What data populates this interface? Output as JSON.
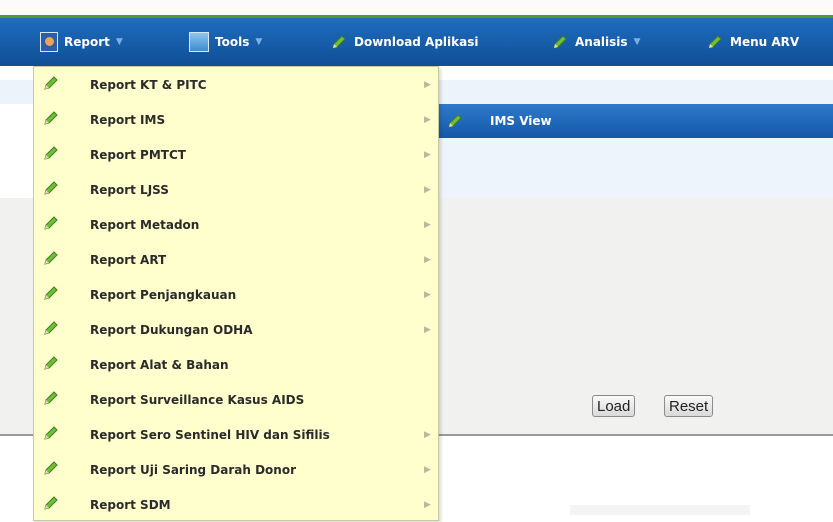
{
  "nav": {
    "report": "Report",
    "tools": "Tools",
    "download": "Download Aplikasi",
    "analisis": "Analisis",
    "menu_arv": "Menu ARV"
  },
  "submenu": {
    "ims_view": "IMS View"
  },
  "buttons": {
    "load": "Load",
    "reset": "Reset"
  },
  "menu_items": [
    {
      "label": "Report KT & PITC",
      "has_submenu": true
    },
    {
      "label": "Report IMS",
      "has_submenu": true
    },
    {
      "label": "Report PMTCT",
      "has_submenu": true
    },
    {
      "label": "Report LJSS",
      "has_submenu": true
    },
    {
      "label": "Report Metadon",
      "has_submenu": true
    },
    {
      "label": "Report ART",
      "has_submenu": true
    },
    {
      "label": "Report Penjangkauan",
      "has_submenu": true
    },
    {
      "label": "Report Dukungan ODHA",
      "has_submenu": true
    },
    {
      "label": "Report Alat & Bahan",
      "has_submenu": false
    },
    {
      "label": "Report Surveillance Kasus AIDS",
      "has_submenu": false
    },
    {
      "label": "Report Sero Sentinel HIV dan Sifilis",
      "has_submenu": true
    },
    {
      "label": "Report Uji Saring Darah Donor",
      "has_submenu": true
    },
    {
      "label": "Report SDM",
      "has_submenu": true
    }
  ],
  "colors": {
    "navbar": "#1a64b5",
    "dropdown_bg": "#ffffce",
    "highlight": "#1f66b8",
    "pencil": "#5fae2e"
  }
}
